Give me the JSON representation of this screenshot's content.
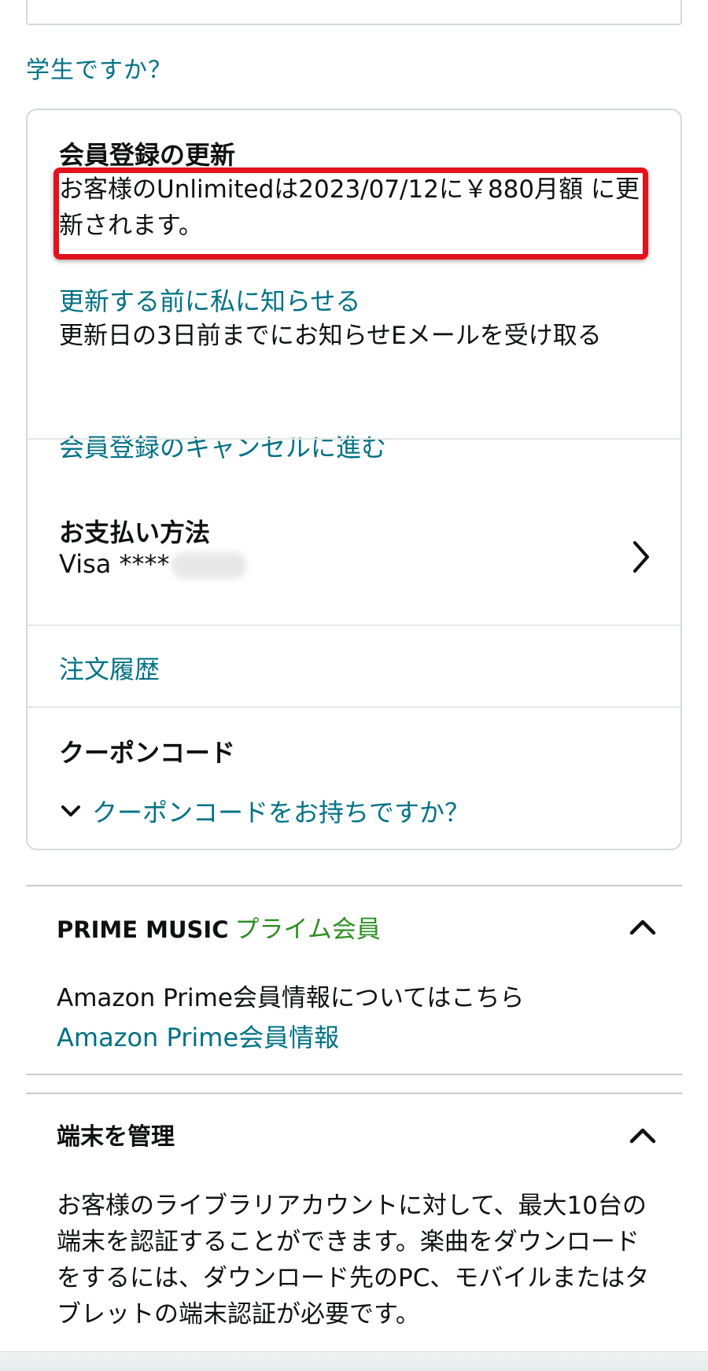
{
  "student_link": "学生ですか？",
  "membership": {
    "title": "会員登録の更新",
    "renewal_text": "お客様のUnlimitedは2023/07/12に￥880月額 に更新されます。",
    "notify_link": "更新する前に私に知らせる",
    "notify_text": "更新日の3日前までにお知らせEメールを受け取る",
    "cancel_link": "会員登録のキャンセルに進む"
  },
  "payment": {
    "title": "お支払い方法",
    "card_value": "Visa ****"
  },
  "orders_link": "注文履歴",
  "coupon": {
    "title": "クーポンコード",
    "toggle_link": "クーポンコードをお持ちですか？"
  },
  "prime_music": {
    "title": "PRIME MUSIC",
    "badge": "プライム会員",
    "text": "Amazon Prime会員情報についてはこちら",
    "link": "Amazon Prime会員情報"
  },
  "devices": {
    "title": "端末を管理",
    "text": "お客様のライブラリアカウントに対して、最大10台の端末を認証することができます。楽曲をダウンロードをするには、ダウンロード先のPC、モバイルまたはタブレットの端末認証が必要です。"
  },
  "colors": {
    "link": "#007185",
    "prime_green": "#2f8f24",
    "highlight_red": "#e3121c"
  }
}
